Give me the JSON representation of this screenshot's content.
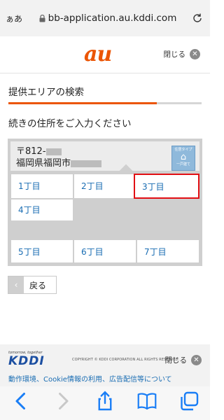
{
  "browser": {
    "aa_label": "ぁあ",
    "url": "bb-application.au.kddi.com"
  },
  "header": {
    "logo_text": "au",
    "close_label": "閉じる"
  },
  "page": {
    "title": "提供エリアの検索",
    "prompt": "続きの住所をご入力ください",
    "progress_fraction": 0.74
  },
  "address": {
    "postal": "〒812-",
    "line": "福岡県福岡市",
    "badge_top": "住居タイプ",
    "badge_bottom": "一戸建て"
  },
  "chome_options": [
    {
      "label": "1丁目",
      "selected": false
    },
    {
      "label": "2丁目",
      "selected": false
    },
    {
      "label": "3丁目",
      "selected": true
    },
    {
      "label": "4丁目",
      "selected": false
    },
    {
      "label": "5丁目",
      "selected": false
    },
    {
      "label": "6丁目",
      "selected": false
    },
    {
      "label": "7丁目",
      "selected": false
    }
  ],
  "back_button": {
    "label": "戻る"
  },
  "footer": {
    "tagline": "tomorrow, together",
    "logo_text": "KDDI",
    "copyright": "COPYRIGHT © KDDI CORPORATION ALL RIGHTS RESERVED.",
    "close_label": "閉じる",
    "links": "動作環境、Cookie情報の利用、広告配信等について"
  },
  "colors": {
    "brand_orange": "#eb5505",
    "link_blue": "#1a6db3",
    "selected_red": "#e20f14",
    "kddi_blue": "#1c4fa1"
  }
}
